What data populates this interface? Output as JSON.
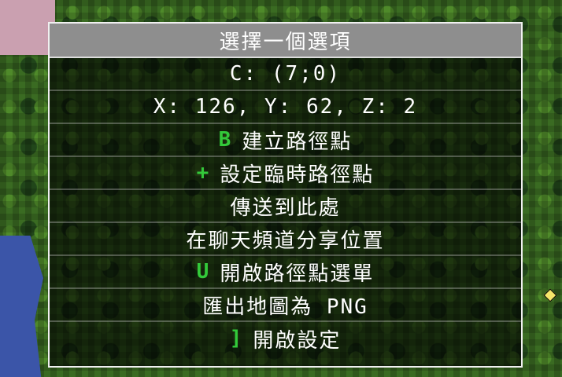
{
  "title": "選擇一個選項",
  "chunk_label": "C: (7;0)",
  "coords_label": "X: 126, Y: 62, Z: 2",
  "options": [
    {
      "key": "B",
      "label": "建立路徑點"
    },
    {
      "key": "+",
      "label": "設定臨時路徑點"
    },
    {
      "key": "",
      "label": "傳送到此處"
    },
    {
      "key": "",
      "label": "在聊天頻道分享位置"
    },
    {
      "key": "U",
      "label": "開啟路徑點選單"
    },
    {
      "key": "",
      "label": "匯出地圖為 PNG"
    },
    {
      "key": "]",
      "label": "開啟設定"
    }
  ],
  "colors": {
    "key": "#33c93a",
    "title_bg": "#8e8e8e"
  }
}
